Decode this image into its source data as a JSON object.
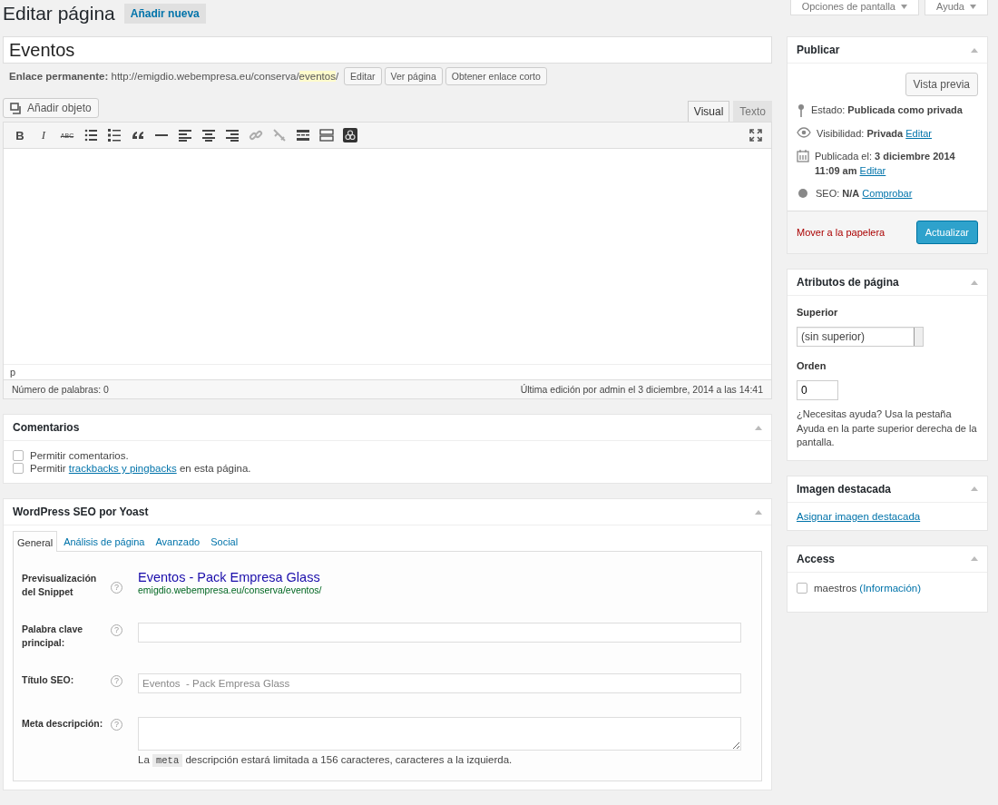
{
  "header": {
    "title": "Editar página",
    "add_new": "Añadir nueva",
    "screen_options": "Opciones de pantalla",
    "help": "Ayuda"
  },
  "post_title": "Eventos",
  "permalink": {
    "label": "Enlace permanente:",
    "url_prefix": "http://emigdio.webempresa.eu/conserva/",
    "slug": "eventos",
    "url_suffix": "/",
    "buttons": [
      "Editar",
      "Ver página",
      "Obtener enlace corto"
    ]
  },
  "editor": {
    "add_media": "Añadir objeto",
    "tabs": [
      {
        "label": "Visual",
        "selected": true
      },
      {
        "label": "Texto",
        "selected": false
      }
    ],
    "toolbar": [
      {
        "kind": "bold",
        "label": "B"
      },
      {
        "kind": "italic",
        "label": "I"
      },
      {
        "kind": "strike",
        "label": "ABC"
      },
      {
        "kind": "bullets"
      },
      {
        "kind": "numbers"
      },
      {
        "kind": "quote"
      },
      {
        "kind": "hr"
      },
      {
        "kind": "align-left"
      },
      {
        "kind": "align-center"
      },
      {
        "kind": "align-right"
      },
      {
        "kind": "link",
        "disabled": true
      },
      {
        "kind": "unlink",
        "disabled": true
      },
      {
        "kind": "more"
      },
      {
        "kind": "toolbar"
      },
      {
        "kind": "plugin"
      }
    ],
    "path": "p",
    "word_count": "Número de palabras: 0",
    "last_edit": "Última edición por admin el 3 diciembre, 2014 a las 14:41"
  },
  "comments": {
    "title": "Comentarios",
    "options": [
      {
        "before": "Permitir comentarios.",
        "checked": false
      },
      {
        "before": "Permitir ",
        "link": "trackbacks y pingbacks",
        "after": " en esta página.",
        "checked": false
      }
    ]
  },
  "seo": {
    "title": "WordPress SEO por Yoast",
    "tabs": [
      {
        "label": "General",
        "selected": true
      },
      {
        "label": "Análisis de página",
        "selected": false
      },
      {
        "label": "Avanzado",
        "selected": false
      },
      {
        "label": "Social",
        "selected": false
      }
    ],
    "help_mark": "?",
    "snippet_label": "Previsualización del Snippet",
    "snippet_title": "Eventos - Pack Empresa Glass",
    "snippet_url": "emigdio.webempresa.eu/conserva/eventos/",
    "fields": [
      {
        "kind": "input",
        "label": "Palabra clave principal:"
      },
      {
        "kind": "input",
        "label": "Título SEO:",
        "placeholder": "Eventos  - Pack Empresa Glass"
      },
      {
        "kind": "textarea",
        "label": "Meta descripción:",
        "note": {
          "before": "La ",
          "code": "meta",
          "after": " descripción estará limitada a 156 caracteres, caracteres a la izquierda."
        }
      }
    ]
  },
  "publish": {
    "title": "Publicar",
    "preview": "Vista previa",
    "status": "Estado: **Publicada como privada**",
    "visibility": "Visibilidad: **Privada**",
    "visibility_link": "Editar",
    "published": "Publicada el: **3 diciembre 2014 11:09 am**",
    "published_link": "Editar",
    "seo": "SEO: **N/A**",
    "seo_link": "Comprobar",
    "trash": "Mover a la papelera",
    "update": "Actualizar"
  },
  "attributes": {
    "title": "Atributos de página",
    "parent_label": "Superior",
    "parent_value": "(sin superior)",
    "order_label": "Orden",
    "order_value": "0",
    "help": "¿Necesitas ayuda? Usa la pestaña Ayuda en la parte superior derecha de la pantalla."
  },
  "featured": {
    "title": "Imagen destacada",
    "link": "Asignar imagen destacada"
  },
  "access": {
    "title": "Access",
    "items": [
      {
        "label": "maestros",
        "info": "(Información)",
        "checked": false
      }
    ]
  }
}
